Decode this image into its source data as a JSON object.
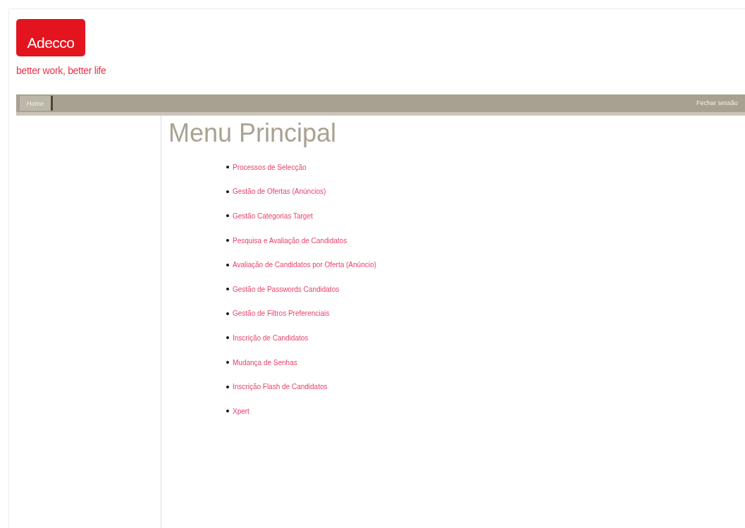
{
  "logo": {
    "text": "Adecco"
  },
  "tagline": "better work, better life",
  "nav": {
    "tabs": [
      {
        "label": "Home",
        "selected": true
      }
    ],
    "logout": "Fechar sessão"
  },
  "title": "Menu Principal",
  "menu": [
    "Processos de Selecção",
    "Gestão de Ofertas (Anúncios)",
    "Gestão Categorias Target",
    "Pesquisa e Avaliação de Candidatos",
    "Avaliação de Candidatos por Oferta (Anúncio)",
    "Gestão de Passwords Candidatos",
    "Gestão de Filtros Preferenciais",
    "Inscrição de Candidatos",
    "Mudança de Senhas",
    "Inscrição Flash de Candidatos",
    "Xpert"
  ]
}
